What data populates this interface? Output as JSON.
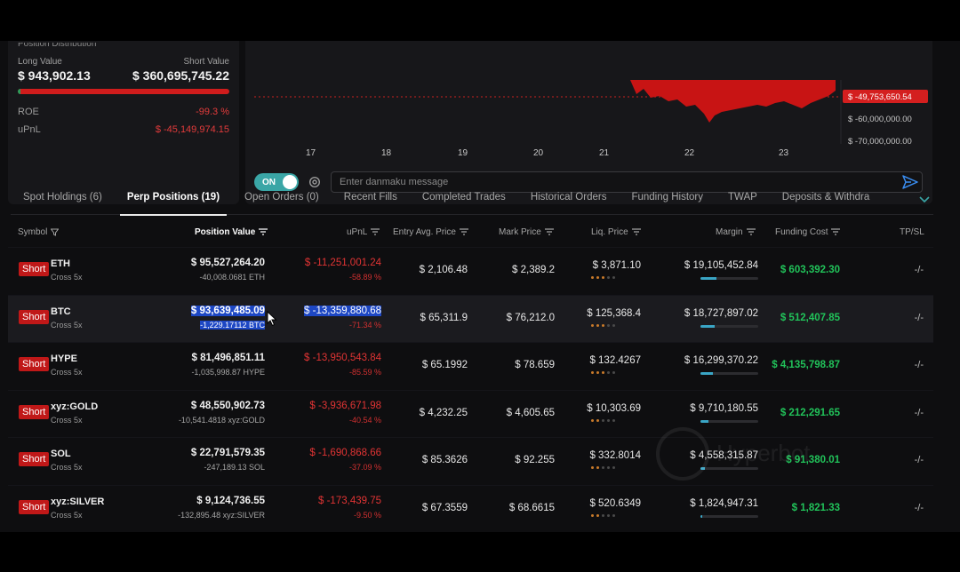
{
  "position_distribution": {
    "title": "Position Distribution",
    "long_label": "Long Value",
    "short_label": "Short Value",
    "long_value": "$ 943,902.13",
    "short_value": "$ 360,695,745.22",
    "long_fraction": 0.0026,
    "roe_label": "ROE",
    "roe_value": "-99.3 %",
    "upnl_label": "uPnL",
    "upnl_value": "$ -45,149,974.15"
  },
  "chart": {
    "x_ticks": [
      "17",
      "18",
      "19",
      "20",
      "21",
      "22",
      "23"
    ],
    "y_ticks": [
      "$ -60,000,000.00",
      "$ -70,000,000.00"
    ],
    "current_value_label": "$ -49,753,650.54",
    "fill_color": "#c81414"
  },
  "danmaku": {
    "toggle_label": "ON",
    "placeholder": "Enter danmaku message"
  },
  "tabs": [
    {
      "label": "Spot Holdings (6)",
      "active": false
    },
    {
      "label": "Perp Positions (19)",
      "active": true
    },
    {
      "label": "Open Orders (0)",
      "active": false
    },
    {
      "label": "Recent Fills",
      "active": false
    },
    {
      "label": "Completed Trades",
      "active": false
    },
    {
      "label": "Historical Orders",
      "active": false
    },
    {
      "label": "Funding History",
      "active": false
    },
    {
      "label": "TWAP",
      "active": false
    },
    {
      "label": "Deposits & Withdra",
      "active": false
    }
  ],
  "table": {
    "headers": {
      "symbol": "Symbol",
      "position_value": "Position Value",
      "upnl": "uPnL",
      "entry": "Entry Avg. Price",
      "mark": "Mark Price",
      "liq": "Liq. Price",
      "margin": "Margin",
      "funding": "Funding Cost",
      "tpsl": "TP/SL"
    },
    "rows": [
      {
        "side": "Short",
        "symbol": "ETH",
        "leverage": "Cross 5x",
        "pos_value": "$ 95,527,264.20",
        "pos_size": "-40,008.0681 ETH",
        "upnl": "$ -11,251,001.24",
        "upnl_pct": "-58.89 %",
        "entry": "$ 2,106.48",
        "mark": "$ 2,389.2",
        "liq": "$ 3,871.10",
        "liq_risk": 3,
        "margin": "$ 19,105,452.84",
        "margin_fill": 0.27,
        "funding": "$ 603,392.30",
        "tpsl": "-/-"
      },
      {
        "side": "Short",
        "symbol": "BTC",
        "leverage": "Cross 5x",
        "pos_value": "$ 93,639,485.09",
        "pos_size": "-1,229.17112 BTC",
        "upnl": "$ -13,359,880.68",
        "upnl_pct": "-71.34 %",
        "entry": "$ 65,311.9",
        "mark": "$ 76,212.0",
        "liq": "$ 125,368.4",
        "liq_risk": 3,
        "margin": "$ 18,727,897.02",
        "margin_fill": 0.25,
        "funding": "$ 512,407.85",
        "tpsl": "-/-"
      },
      {
        "side": "Short",
        "symbol": "HYPE",
        "leverage": "Cross 5x",
        "pos_value": "$ 81,496,851.11",
        "pos_size": "-1,035,998.87 HYPE",
        "upnl": "$ -13,950,543.84",
        "upnl_pct": "-85.59 %",
        "entry": "$ 65.1992",
        "mark": "$ 78.659",
        "liq": "$ 132.4267",
        "liq_risk": 3,
        "margin": "$ 16,299,370.22",
        "margin_fill": 0.22,
        "funding": "$ 4,135,798.87",
        "tpsl": "-/-"
      },
      {
        "side": "Short",
        "symbol": "xyz:GOLD",
        "leverage": "Cross 5x",
        "pos_value": "$ 48,550,902.73",
        "pos_size": "-10,541.4818 xyz:GOLD",
        "upnl": "$ -3,936,671.98",
        "upnl_pct": "-40.54 %",
        "entry": "$ 4,232.25",
        "mark": "$ 4,605.65",
        "liq": "$ 10,303.69",
        "liq_risk": 2,
        "margin": "$ 9,710,180.55",
        "margin_fill": 0.14,
        "funding": "$ 212,291.65",
        "tpsl": "-/-"
      },
      {
        "side": "Short",
        "symbol": "SOL",
        "leverage": "Cross 5x",
        "pos_value": "$ 22,791,579.35",
        "pos_size": "-247,189.13 SOL",
        "upnl": "$ -1,690,868.66",
        "upnl_pct": "-37.09 %",
        "entry": "$ 85.3626",
        "mark": "$ 92.255",
        "liq": "$ 332.8014",
        "liq_risk": 2,
        "margin": "$ 4,558,315.87",
        "margin_fill": 0.07,
        "funding": "$ 91,380.01",
        "tpsl": "-/-"
      },
      {
        "side": "Short",
        "symbol": "xyz:SILVER",
        "leverage": "Cross 5x",
        "pos_value": "$ 9,124,736.55",
        "pos_size": "-132,895.48 xyz:SILVER",
        "upnl": "$ -173,439.75",
        "upnl_pct": "-9.50 %",
        "entry": "$ 67.3559",
        "mark": "$ 68.6615",
        "liq": "$ 520.6349",
        "liq_risk": 2,
        "margin": "$ 1,824,947.31",
        "margin_fill": 0.03,
        "funding": "$ 1,821.33",
        "tpsl": "-/-"
      }
    ]
  }
}
